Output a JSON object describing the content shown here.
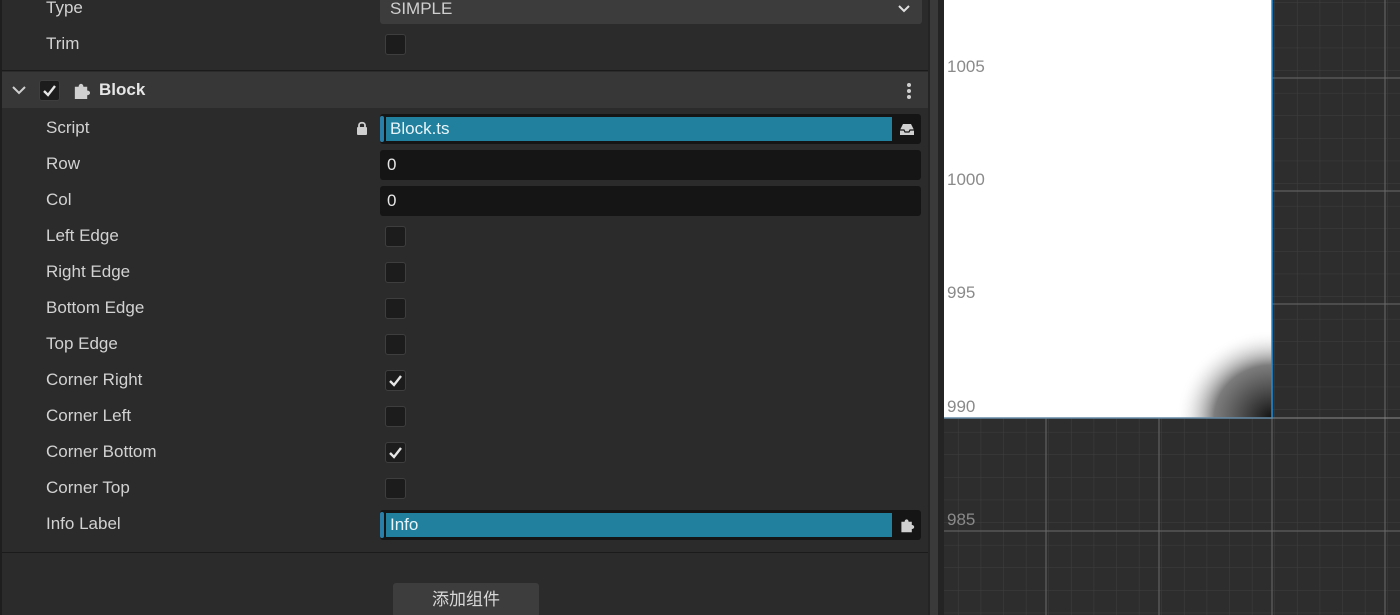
{
  "sprite_props": {
    "type_label": "Type",
    "type_value": "SIMPLE",
    "trim_label": "Trim",
    "trim_checked": false
  },
  "component": {
    "title": "Block",
    "enabled": true,
    "script_label": "Script",
    "script_value": "Block.ts",
    "fields": [
      {
        "label": "Row",
        "value": "0"
      },
      {
        "label": "Col",
        "value": "0"
      }
    ],
    "checks": [
      {
        "label": "Left Edge",
        "checked": false
      },
      {
        "label": "Right Edge",
        "checked": false
      },
      {
        "label": "Bottom Edge",
        "checked": false
      },
      {
        "label": "Top Edge",
        "checked": false
      },
      {
        "label": "Corner Right",
        "checked": true
      },
      {
        "label": "Corner Left",
        "checked": false
      },
      {
        "label": "Corner Bottom",
        "checked": true
      },
      {
        "label": "Corner Top",
        "checked": false
      }
    ],
    "info_label": "Info Label",
    "info_value": "Info"
  },
  "add_component_label": "添加组件",
  "scene": {
    "ruler_labels": [
      "1005",
      "1000",
      "995",
      "990",
      "985"
    ]
  },
  "colors": {
    "accent": "#21809e",
    "selection_outline": "#1d8fe0"
  }
}
